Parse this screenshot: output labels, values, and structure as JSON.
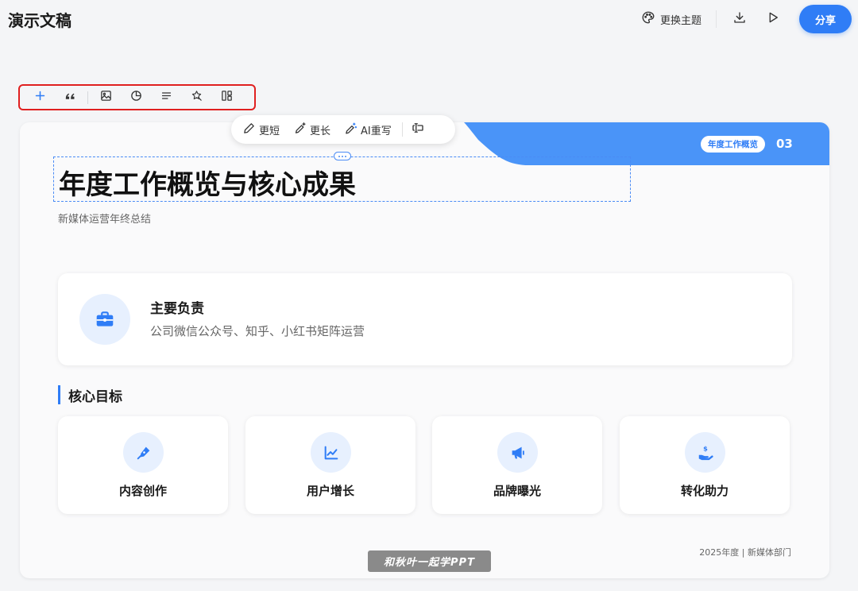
{
  "app": {
    "title": "演示文稿"
  },
  "header": {
    "theme_button": {
      "label": "更换主题",
      "icon": "palette-icon"
    },
    "download_icon": "download-icon",
    "play_icon": "play-icon",
    "share_button": {
      "label": "分享"
    }
  },
  "toolbar": {
    "items": [
      {
        "name": "add-icon",
        "label": "+"
      },
      {
        "name": "quote-icon",
        "label": "“"
      },
      {
        "name": "image-icon"
      },
      {
        "name": "chart-icon"
      },
      {
        "name": "text-align-icon"
      },
      {
        "name": "magic-wand-icon"
      },
      {
        "name": "layout-icon"
      }
    ]
  },
  "ai_toolbar": {
    "shorter": "更短",
    "longer": "更长",
    "rewrite": "AI重写",
    "more_icon": "text-cursor-icon"
  },
  "slide": {
    "tag": "年度工作概览",
    "number": "03",
    "title": "年度工作概览与核心成果",
    "subtitle": "新媒体运营年终总结",
    "responsibility": {
      "heading": "主要负责",
      "description": "公司微信公众号、知乎、小红书矩阵运营",
      "icon": "briefcase-icon"
    },
    "section_title": "核心目标",
    "goals": [
      {
        "label": "内容创作",
        "icon": "pen-icon"
      },
      {
        "label": "用户增长",
        "icon": "line-chart-icon"
      },
      {
        "label": "品牌曝光",
        "icon": "megaphone-icon"
      },
      {
        "label": "转化助力",
        "icon": "hand-coin-icon"
      }
    ],
    "footer": "2025年度 | 新媒体部门"
  },
  "watermark": "和秋叶一起学PPT",
  "colors": {
    "accent": "#2f7df6",
    "accent_light": "#e7f0fe",
    "highlight_border": "#e02020"
  }
}
